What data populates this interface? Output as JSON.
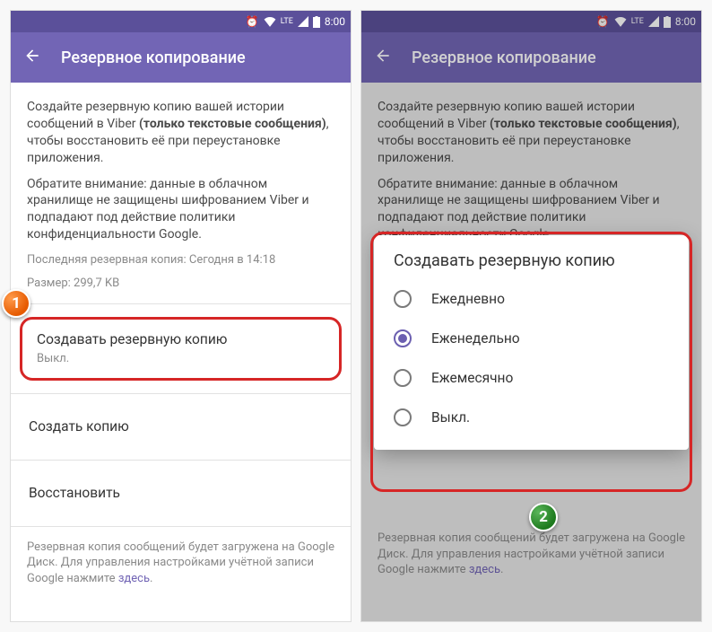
{
  "statusbar": {
    "time": "8:00",
    "lte": "LTE"
  },
  "appbar": {
    "title": "Резервное копирование"
  },
  "desc": {
    "line1a": "Создайте резервную копию вашей истории сообщений в Viber ",
    "bold": "(только текстовые сообщения)",
    "line1b": ", чтобы восстановить её при переустановке приложения.",
    "line2": "Обратите внимание: данные в облачном хранилище не защищены шифрованием Viber и подпадают под действие политики конфиденциальности Google."
  },
  "meta": {
    "last": "Последняя резервная копия: Сегодня в 14:18",
    "size": "Размер: 299,7 KB"
  },
  "settings": {
    "autobackup_title": "Создавать резервную копию",
    "autobackup_value": "Выкл.",
    "backup_now": "Создать копию",
    "restore": "Восстановить"
  },
  "footer": {
    "text": "Резервная копия сообщений будет загружена на Google Диск. Для управления настройками учётной записи Google нажмите ",
    "link": "здесь",
    "dot": "."
  },
  "dialog": {
    "title": "Создавать резервную копию",
    "options": [
      "Ежедневно",
      "Еженедельно",
      "Ежемесячно",
      "Выкл."
    ],
    "selected_index": 1
  },
  "badges": {
    "one": "1",
    "two": "2"
  }
}
